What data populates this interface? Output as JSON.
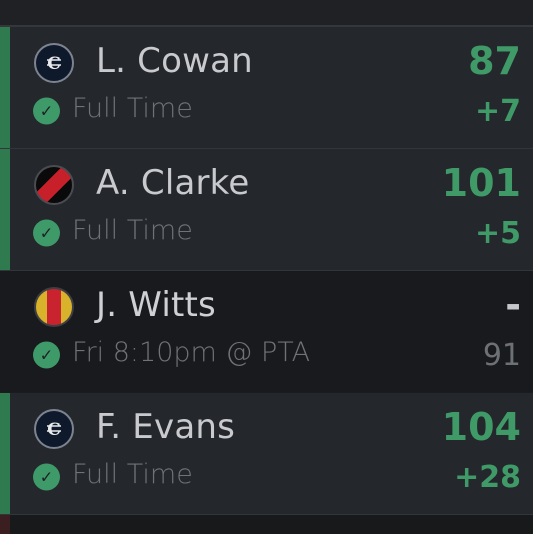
{
  "players": [
    {
      "name": "L. Cowan",
      "club_logo": "carlton-logo",
      "status_icon": "check-circle-icon",
      "status": "Full Time",
      "score": "87",
      "delta": "+7",
      "state": "complete",
      "accent_color": "#2f7a4f"
    },
    {
      "name": "A. Clarke",
      "club_logo": "essendon-logo",
      "status_icon": "check-circle-icon",
      "status": "Full Time",
      "score": "101",
      "delta": "+5",
      "state": "complete",
      "accent_color": "#2f7a4f"
    },
    {
      "name": "J. Witts",
      "club_logo": "adelaide-logo",
      "status_icon": "check-circle-icon",
      "status": "Fri 8:10pm @ PTA",
      "score": "-",
      "delta": "91",
      "state": "pending"
    },
    {
      "name": "F. Evans",
      "club_logo": "carlton-logo",
      "status_icon": "check-circle-icon",
      "status": "Full Time",
      "score": "104",
      "delta": "+28",
      "state": "complete",
      "accent_color": "#2f7a4f"
    }
  ],
  "colors": {
    "positive": "#3f9a68",
    "accent": "#2f7a4f",
    "row_bg": "#24272b",
    "pending_row_bg": "#191a1d",
    "muted_text": "#6f7276"
  }
}
